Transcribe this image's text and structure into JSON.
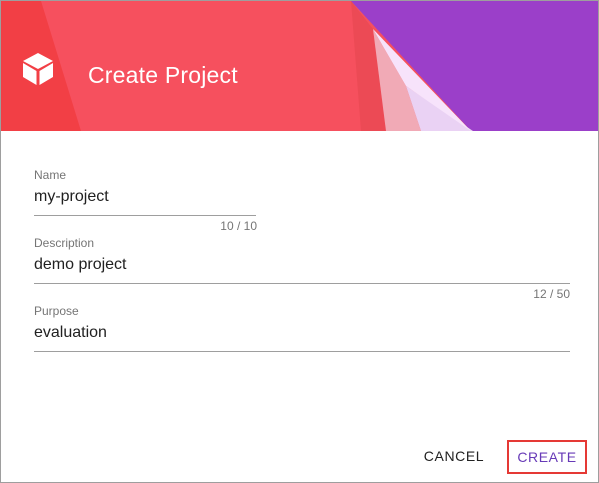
{
  "dialog": {
    "title": "Create Project",
    "logo_icon": "cube-icon"
  },
  "fields": {
    "name": {
      "label": "Name",
      "value": "my-project",
      "counter": "10 / 10"
    },
    "description": {
      "label": "Description",
      "value": "demo project",
      "counter": "12 / 50"
    },
    "purpose": {
      "label": "Purpose",
      "value": "evaluation"
    }
  },
  "actions": {
    "cancel_label": "CANCEL",
    "create_label": "CREATE"
  },
  "colors": {
    "header_red": "#f44f5e",
    "header_purple": "#9b3fc9",
    "accent": "#673ab7",
    "highlight_border": "#e53935"
  }
}
